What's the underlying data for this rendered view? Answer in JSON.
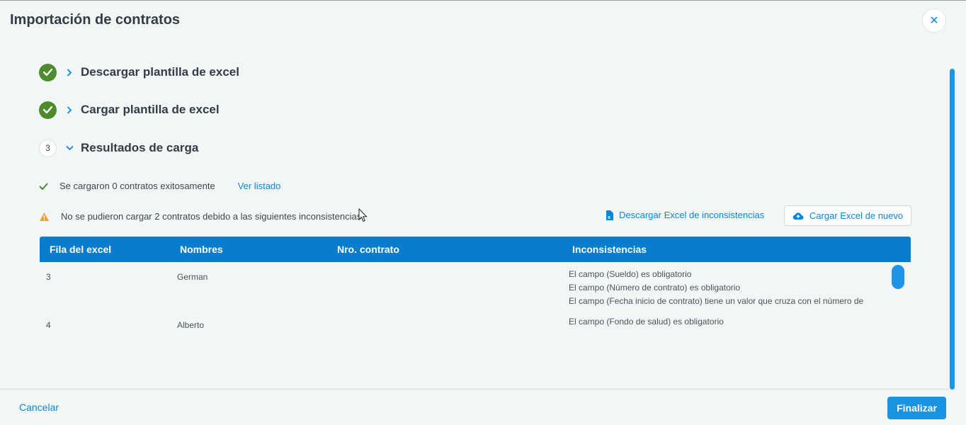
{
  "dialog": {
    "title": "Importación de contratos"
  },
  "steps": [
    {
      "label": "Descargar plantilla de excel",
      "status": "done"
    },
    {
      "label": "Cargar plantilla de excel",
      "status": "done"
    },
    {
      "number": "3",
      "label": "Resultados de carga",
      "status": "current"
    }
  ],
  "results": {
    "success_text": "Se cargaron 0 contratos exitosamente",
    "view_list_link": "Ver listado",
    "warning_text": "No se pudieron cargar 2 contratos debido a las siguientes inconsistencias:",
    "download_link": "Descargar Excel de inconsistencias",
    "reload_button": "Cargar Excel de nuevo"
  },
  "table": {
    "columns": [
      "Fila del excel",
      "Nombres",
      "Nro. contrato",
      "Inconsistencias"
    ],
    "rows": [
      {
        "fila": "3",
        "nombres": "German",
        "contrato": "",
        "inconsistencias": [
          "El campo (Sueldo) es obligatorio",
          "El campo (Número de contrato) es obligatorio",
          "El campo (Fecha inicio de contrato) tiene un valor que cruza con el número de"
        ]
      },
      {
        "fila": "4",
        "nombres": "Alberto",
        "contrato": "",
        "inconsistencias": [
          "El campo (Fondo de salud) es obligatorio"
        ]
      }
    ]
  },
  "footer": {
    "cancel": "Cancelar",
    "finish": "Finalizar"
  },
  "colors": {
    "accent": "#0a86d6",
    "header": "#0a7ccd",
    "success": "#4d8b2c",
    "warning": "#f0a030"
  }
}
